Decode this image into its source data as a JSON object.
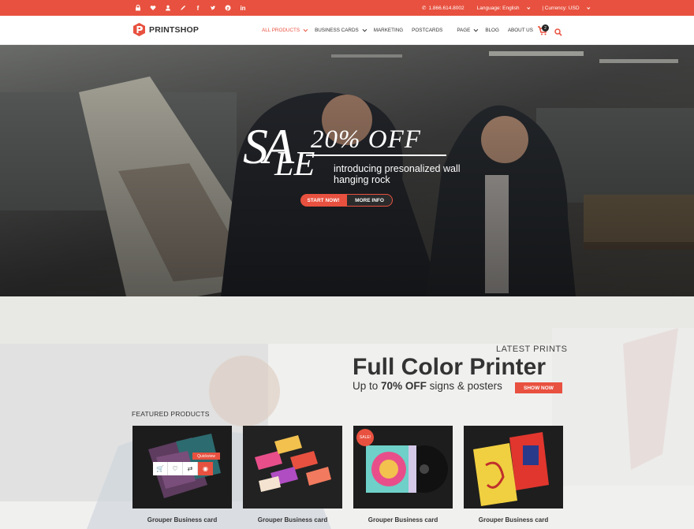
{
  "topbar": {
    "social_icons": [
      "lock-icon",
      "heart-icon",
      "user-icon",
      "pencil-icon",
      "facebook-icon",
      "twitter-icon",
      "pinterest-icon",
      "linkedin-icon"
    ],
    "phone": "1.866.614.8002",
    "language": "Language: English",
    "currency": "| Currency: USD",
    "colors": {
      "accent": "#e8513f"
    }
  },
  "header": {
    "logo_text": "PRINTSHOP",
    "nav": [
      {
        "label": "ALL PRODUCTS",
        "dropdown": true,
        "active": true
      },
      {
        "label": "BUSINESS CARDS",
        "dropdown": true
      },
      {
        "label": "MARKETING",
        "dropdown": false
      },
      {
        "label": "POSTCARDS",
        "dropdown": false
      },
      {
        "label": "PAGE",
        "dropdown": true
      },
      {
        "label": "BLOG",
        "dropdown": false
      },
      {
        "label": "ABOUT US",
        "dropdown": false
      }
    ],
    "cart_count": "2"
  },
  "hero": {
    "sale_s": "SA",
    "sale_le": "LE",
    "offer": "20% OFF",
    "tagline": "introducing presonalized wall hanging rock",
    "start_button": "START NOW!",
    "more_button": "MORE INFO"
  },
  "promo": {
    "kicker": "LATEST PRINTS",
    "headline": "Full Color Printer",
    "sub_prefix": "Up to",
    "sub_highlight": "70% OFF",
    "sub_suffix": "signs & posters",
    "button": "SHOW NOW"
  },
  "featured": {
    "heading": "FEATURED PRODUCTS",
    "products": [
      {
        "title": "Grouper Business card"
      },
      {
        "title": "Grouper Business card"
      },
      {
        "title": "Grouper Business card",
        "badge": "SALE!"
      },
      {
        "title": "Grouper Business card"
      }
    ],
    "quickview_label": "Quickview"
  }
}
